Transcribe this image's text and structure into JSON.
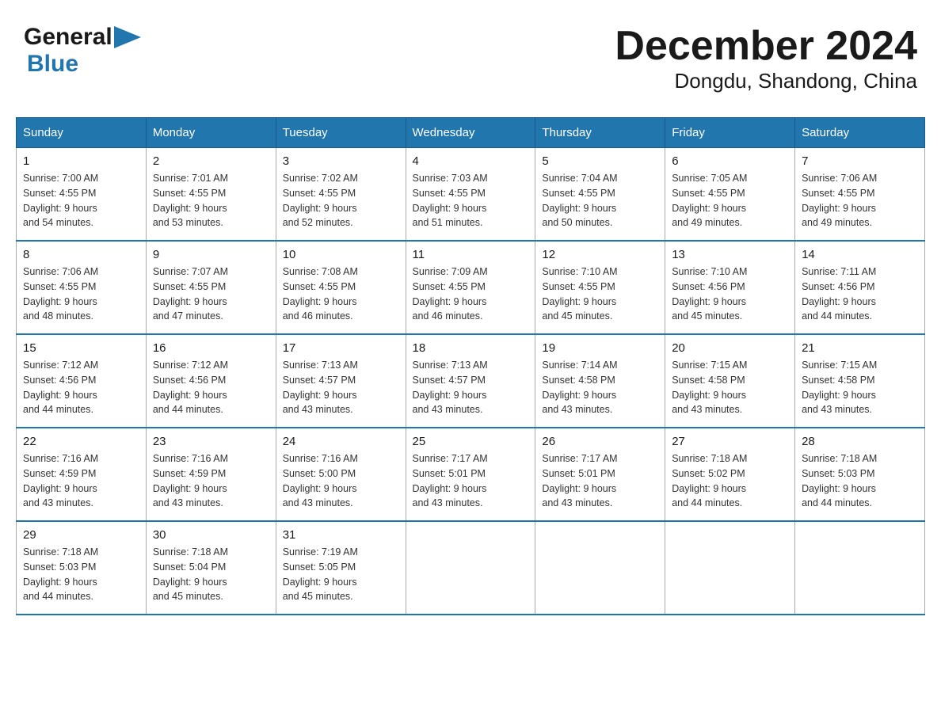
{
  "header": {
    "title": "December 2024",
    "subtitle": "Dongdu, Shandong, China",
    "logo_general": "General",
    "logo_blue": "Blue"
  },
  "weekdays": [
    "Sunday",
    "Monday",
    "Tuesday",
    "Wednesday",
    "Thursday",
    "Friday",
    "Saturday"
  ],
  "weeks": [
    [
      {
        "day": "1",
        "sunrise": "7:00 AM",
        "sunset": "4:55 PM",
        "daylight": "9 hours and 54 minutes."
      },
      {
        "day": "2",
        "sunrise": "7:01 AM",
        "sunset": "4:55 PM",
        "daylight": "9 hours and 53 minutes."
      },
      {
        "day": "3",
        "sunrise": "7:02 AM",
        "sunset": "4:55 PM",
        "daylight": "9 hours and 52 minutes."
      },
      {
        "day": "4",
        "sunrise": "7:03 AM",
        "sunset": "4:55 PM",
        "daylight": "9 hours and 51 minutes."
      },
      {
        "day": "5",
        "sunrise": "7:04 AM",
        "sunset": "4:55 PM",
        "daylight": "9 hours and 50 minutes."
      },
      {
        "day": "6",
        "sunrise": "7:05 AM",
        "sunset": "4:55 PM",
        "daylight": "9 hours and 49 minutes."
      },
      {
        "day": "7",
        "sunrise": "7:06 AM",
        "sunset": "4:55 PM",
        "daylight": "9 hours and 49 minutes."
      }
    ],
    [
      {
        "day": "8",
        "sunrise": "7:06 AM",
        "sunset": "4:55 PM",
        "daylight": "9 hours and 48 minutes."
      },
      {
        "day": "9",
        "sunrise": "7:07 AM",
        "sunset": "4:55 PM",
        "daylight": "9 hours and 47 minutes."
      },
      {
        "day": "10",
        "sunrise": "7:08 AM",
        "sunset": "4:55 PM",
        "daylight": "9 hours and 46 minutes."
      },
      {
        "day": "11",
        "sunrise": "7:09 AM",
        "sunset": "4:55 PM",
        "daylight": "9 hours and 46 minutes."
      },
      {
        "day": "12",
        "sunrise": "7:10 AM",
        "sunset": "4:55 PM",
        "daylight": "9 hours and 45 minutes."
      },
      {
        "day": "13",
        "sunrise": "7:10 AM",
        "sunset": "4:56 PM",
        "daylight": "9 hours and 45 minutes."
      },
      {
        "day": "14",
        "sunrise": "7:11 AM",
        "sunset": "4:56 PM",
        "daylight": "9 hours and 44 minutes."
      }
    ],
    [
      {
        "day": "15",
        "sunrise": "7:12 AM",
        "sunset": "4:56 PM",
        "daylight": "9 hours and 44 minutes."
      },
      {
        "day": "16",
        "sunrise": "7:12 AM",
        "sunset": "4:56 PM",
        "daylight": "9 hours and 44 minutes."
      },
      {
        "day": "17",
        "sunrise": "7:13 AM",
        "sunset": "4:57 PM",
        "daylight": "9 hours and 43 minutes."
      },
      {
        "day": "18",
        "sunrise": "7:13 AM",
        "sunset": "4:57 PM",
        "daylight": "9 hours and 43 minutes."
      },
      {
        "day": "19",
        "sunrise": "7:14 AM",
        "sunset": "4:58 PM",
        "daylight": "9 hours and 43 minutes."
      },
      {
        "day": "20",
        "sunrise": "7:15 AM",
        "sunset": "4:58 PM",
        "daylight": "9 hours and 43 minutes."
      },
      {
        "day": "21",
        "sunrise": "7:15 AM",
        "sunset": "4:58 PM",
        "daylight": "9 hours and 43 minutes."
      }
    ],
    [
      {
        "day": "22",
        "sunrise": "7:16 AM",
        "sunset": "4:59 PM",
        "daylight": "9 hours and 43 minutes."
      },
      {
        "day": "23",
        "sunrise": "7:16 AM",
        "sunset": "4:59 PM",
        "daylight": "9 hours and 43 minutes."
      },
      {
        "day": "24",
        "sunrise": "7:16 AM",
        "sunset": "5:00 PM",
        "daylight": "9 hours and 43 minutes."
      },
      {
        "day": "25",
        "sunrise": "7:17 AM",
        "sunset": "5:01 PM",
        "daylight": "9 hours and 43 minutes."
      },
      {
        "day": "26",
        "sunrise": "7:17 AM",
        "sunset": "5:01 PM",
        "daylight": "9 hours and 43 minutes."
      },
      {
        "day": "27",
        "sunrise": "7:18 AM",
        "sunset": "5:02 PM",
        "daylight": "9 hours and 44 minutes."
      },
      {
        "day": "28",
        "sunrise": "7:18 AM",
        "sunset": "5:03 PM",
        "daylight": "9 hours and 44 minutes."
      }
    ],
    [
      {
        "day": "29",
        "sunrise": "7:18 AM",
        "sunset": "5:03 PM",
        "daylight": "9 hours and 44 minutes."
      },
      {
        "day": "30",
        "sunrise": "7:18 AM",
        "sunset": "5:04 PM",
        "daylight": "9 hours and 45 minutes."
      },
      {
        "day": "31",
        "sunrise": "7:19 AM",
        "sunset": "5:05 PM",
        "daylight": "9 hours and 45 minutes."
      },
      null,
      null,
      null,
      null
    ]
  ]
}
